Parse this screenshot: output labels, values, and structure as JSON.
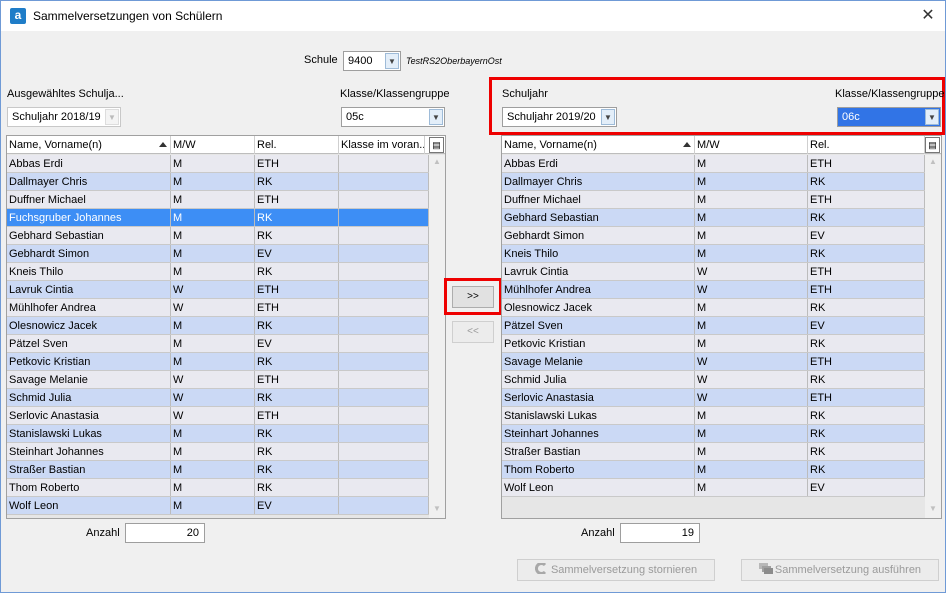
{
  "window": {
    "title": "Sammelversetzungen von Schülern",
    "app_icon": "a"
  },
  "school": {
    "label": "Schule",
    "value": "9400",
    "name": "TestRS2OberbayernOst"
  },
  "left": {
    "year_label": "Ausgewähltes Schulja...",
    "year_value": "Schuljahr 2018/19",
    "class_label": "Klasse/Klassengruppe",
    "class_value": "05c",
    "columns": [
      "Name, Vorname(n)",
      "M/W",
      "Rel.",
      "Klasse im voran..."
    ],
    "rows": [
      [
        "Abbas Erdi",
        "M",
        "ETH",
        ""
      ],
      [
        "Dallmayer Chris",
        "M",
        "RK",
        ""
      ],
      [
        "Duffner Michael",
        "M",
        "ETH",
        ""
      ],
      [
        "Fuchsgruber Johannes",
        "M",
        "RK",
        ""
      ],
      [
        "Gebhard Sebastian",
        "M",
        "RK",
        ""
      ],
      [
        "Gebhardt Simon",
        "M",
        "EV",
        ""
      ],
      [
        "Kneis Thilo",
        "M",
        "RK",
        ""
      ],
      [
        "Lavruk Cintia",
        "W",
        "ETH",
        ""
      ],
      [
        "Mühlhofer Andrea",
        "W",
        "ETH",
        ""
      ],
      [
        "Olesnowicz Jacek",
        "M",
        "RK",
        ""
      ],
      [
        "Pätzel Sven",
        "M",
        "EV",
        ""
      ],
      [
        "Petkovic Kristian",
        "M",
        "RK",
        ""
      ],
      [
        "Savage Melanie",
        "W",
        "ETH",
        ""
      ],
      [
        "Schmid Julia",
        "W",
        "RK",
        ""
      ],
      [
        "Serlovic Anastasia",
        "W",
        "ETH",
        ""
      ],
      [
        "Stanislawski Lukas",
        "M",
        "RK",
        ""
      ],
      [
        "Steinhart Johannes",
        "M",
        "RK",
        ""
      ],
      [
        "Straßer Bastian",
        "M",
        "RK",
        ""
      ],
      [
        "Thom Roberto",
        "M",
        "RK",
        ""
      ],
      [
        "Wolf Leon",
        "M",
        "EV",
        ""
      ]
    ],
    "selected_row": 3,
    "count_label": "Anzahl",
    "count_value": "20"
  },
  "right": {
    "year_label": "Schuljahr",
    "year_value": "Schuljahr 2019/20",
    "class_label": "Klasse/Klassengruppe",
    "class_value": "06c",
    "columns": [
      "Name, Vorname(n)",
      "M/W",
      "Rel."
    ],
    "rows": [
      [
        "Abbas Erdi",
        "M",
        "ETH"
      ],
      [
        "Dallmayer Chris",
        "M",
        "RK"
      ],
      [
        "Duffner Michael",
        "M",
        "ETH"
      ],
      [
        "Gebhard Sebastian",
        "M",
        "RK"
      ],
      [
        "Gebhardt Simon",
        "M",
        "EV"
      ],
      [
        "Kneis Thilo",
        "M",
        "RK"
      ],
      [
        "Lavruk Cintia",
        "W",
        "ETH"
      ],
      [
        "Mühlhofer Andrea",
        "W",
        "ETH"
      ],
      [
        "Olesnowicz Jacek",
        "M",
        "RK"
      ],
      [
        "Pätzel Sven",
        "M",
        "EV"
      ],
      [
        "Petkovic Kristian",
        "M",
        "RK"
      ],
      [
        "Savage Melanie",
        "W",
        "ETH"
      ],
      [
        "Schmid Julia",
        "W",
        "RK"
      ],
      [
        "Serlovic Anastasia",
        "W",
        "ETH"
      ],
      [
        "Stanislawski Lukas",
        "M",
        "RK"
      ],
      [
        "Steinhart Johannes",
        "M",
        "RK"
      ],
      [
        "Straßer Bastian",
        "M",
        "RK"
      ],
      [
        "Thom Roberto",
        "M",
        "RK"
      ],
      [
        "Wolf Leon",
        "M",
        "EV"
      ]
    ],
    "count_label": "Anzahl",
    "count_value": "19"
  },
  "transfer": {
    "move_right_label": ">>",
    "move_left_label": "<<"
  },
  "footer": {
    "cancel_label": "Sammelversetzung stornieren",
    "execute_label": "Sammelversetzung ausführen"
  },
  "colors": {
    "selected_row": "#3d8ef5",
    "alt_row": "#cbd9f5",
    "highlight": "#e00000"
  },
  "icons": {
    "close": "close-icon",
    "dropdown": "chevron-down-icon",
    "column_chooser": "column-chooser-icon"
  }
}
